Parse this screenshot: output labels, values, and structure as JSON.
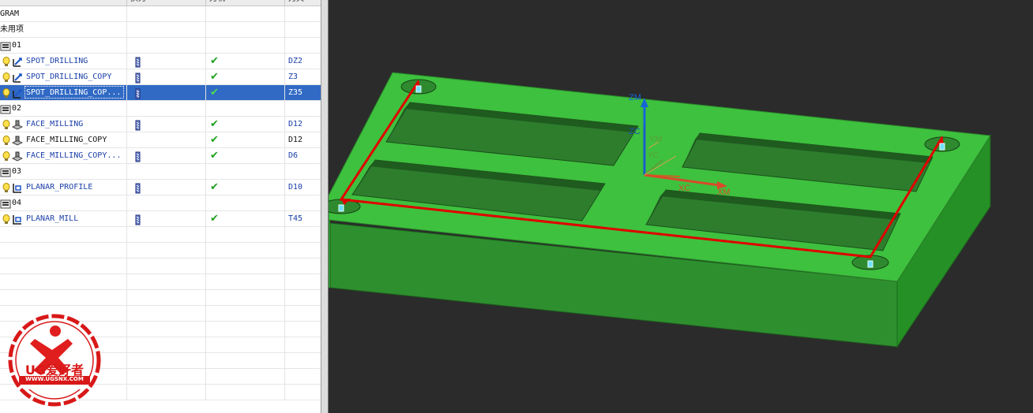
{
  "navigator": {
    "columns": [
      {
        "label": "换刀"
      },
      {
        "label": "刀轨"
      },
      {
        "label": "刀具"
      }
    ],
    "rows": [
      {
        "kind": "root",
        "name": "GRAM"
      },
      {
        "kind": "group",
        "name": "未用项"
      },
      {
        "kind": "program",
        "name": "01"
      },
      {
        "kind": "op",
        "op_type": "drill",
        "name": "SPOT_DRILLING",
        "name_color": "blue",
        "change_tool": true,
        "path": true,
        "tool": "DZ2",
        "tool_color": "blue"
      },
      {
        "kind": "op",
        "op_type": "drill",
        "name": "SPOT_DRILLING_COPY",
        "name_color": "blue",
        "change_tool": true,
        "path": true,
        "tool": "Z3",
        "tool_color": "blue"
      },
      {
        "kind": "op",
        "op_type": "drill",
        "name": "SPOT_DRILLING_COP...",
        "name_color": "white",
        "change_tool": true,
        "path": true,
        "tool": "Z35",
        "tool_color": "white",
        "selected": true
      },
      {
        "kind": "program",
        "name": "02"
      },
      {
        "kind": "op",
        "op_type": "face",
        "name": "FACE_MILLING",
        "name_color": "blue",
        "change_tool": true,
        "path": true,
        "tool": "D12",
        "tool_color": "blue"
      },
      {
        "kind": "op",
        "op_type": "face",
        "name": "FACE_MILLING_COPY",
        "name_color": "black",
        "change_tool": false,
        "path": true,
        "tool": "D12",
        "tool_color": "black"
      },
      {
        "kind": "op",
        "op_type": "face",
        "name": "FACE_MILLING_COPY...",
        "name_color": "blue",
        "change_tool": true,
        "path": true,
        "tool": "D6",
        "tool_color": "blue"
      },
      {
        "kind": "program",
        "name": "03"
      },
      {
        "kind": "op",
        "op_type": "planar",
        "name": "PLANAR_PROFILE",
        "name_color": "blue",
        "change_tool": true,
        "path": true,
        "tool": "D10",
        "tool_color": "blue"
      },
      {
        "kind": "program",
        "name": "04"
      },
      {
        "kind": "op",
        "op_type": "planar",
        "name": "PLANAR_MILL",
        "name_color": "blue",
        "change_tool": true,
        "path": true,
        "tool": "T45",
        "tool_color": "blue"
      }
    ],
    "empty_rows": 11
  },
  "viewport": {
    "part_color": "#3ec13e",
    "toolpath_color": "#e00000",
    "axes": {
      "zm": "ZM",
      "zc": "ZC",
      "ym": "YM",
      "yc": "YC",
      "xc": "XC",
      "xm": "XM"
    }
  },
  "watermark": {
    "brand": "UG爱好者",
    "url": "WWW.UGSNX.COM"
  }
}
